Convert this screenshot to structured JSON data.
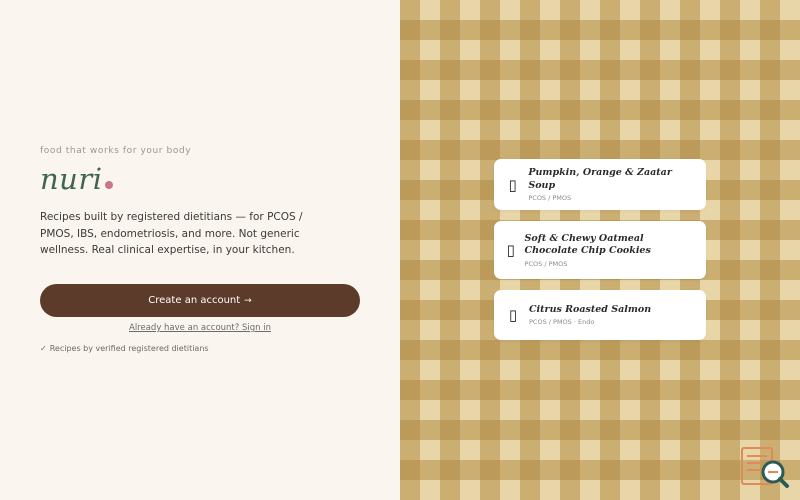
{
  "brand": {
    "tagline": "food that works for your body",
    "name": "nuri",
    "dot_color": "#c9768a",
    "name_color": "#3e6550"
  },
  "intro": {
    "description": "Recipes built by registered dietitians — for PCOS / PMOS, IBS, endometriosis, and more. Not generic wellness. Real clinical expertise, in your kitchen."
  },
  "actions": {
    "create_account_label": "Create an account",
    "create_account_icon": "arrow-right-icon",
    "signin_label": "Already have an account? Sign in",
    "button_color": "#5c3b2b"
  },
  "trust": {
    "label": "Recipes by verified registered dietitians",
    "icon": "check-icon"
  },
  "recipes": [
    {
      "title": "Pumpkin, Orange & Zaatar Soup",
      "tags": "PCOS / PMOS",
      "icon": "recipe-icon"
    },
    {
      "title": "Soft & Chewy Oatmeal Chocolate Chip Cookies",
      "tags": "PCOS / PMOS",
      "icon": "recipe-icon"
    },
    {
      "title": "Citrus Roasted Salmon",
      "tags": "PCOS / PMOS · Endo",
      "icon": "recipe-icon"
    }
  ],
  "background": {
    "pattern": "gingham",
    "base_color": "#e9d6a8",
    "stripe_color": "#b08c46"
  }
}
